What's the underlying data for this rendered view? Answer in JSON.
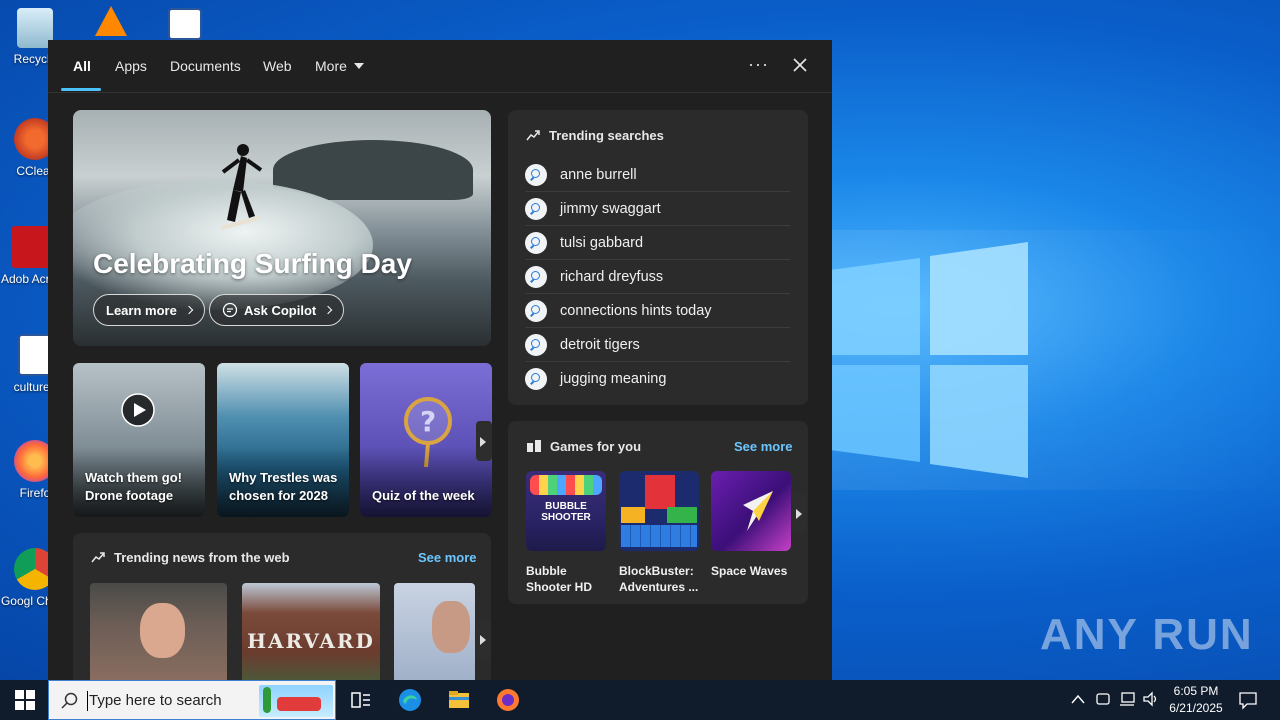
{
  "desktop": {
    "icons": [
      {
        "label": "Recycle"
      },
      {
        "label": "CClear"
      },
      {
        "label": "Adob Acrob"
      },
      {
        "label": "cultureh"
      },
      {
        "label": "Firefo"
      },
      {
        "label": "Googl Chron"
      }
    ],
    "watermark": "ANY RUN"
  },
  "tabs": {
    "all": "All",
    "apps": "Apps",
    "documents": "Documents",
    "web": "Web",
    "more": "More",
    "options": "···"
  },
  "hero": {
    "title": "Celebrating Surfing Day",
    "learn_more": "Learn more",
    "ask_copilot": "Ask Copilot"
  },
  "tiles": [
    {
      "caption": "Watch them go! Drone footage"
    },
    {
      "caption": "Why Trestles was chosen for 2028"
    },
    {
      "caption": "Quiz of the week"
    }
  ],
  "news": {
    "title": "Trending news from the web",
    "see_more": "See more",
    "harvard_text": "HARVARD"
  },
  "trending": {
    "title": "Trending searches",
    "items": [
      "anne burrell",
      "jimmy swaggart",
      "tulsi gabbard",
      "richard dreyfuss",
      "connections hints today",
      "detroit tigers",
      "jugging meaning"
    ]
  },
  "games": {
    "title": "Games for you",
    "see_more": "See more",
    "items": [
      {
        "name": "Bubble Shooter HD",
        "thumb_text": "BUBBLE SHOOTER"
      },
      {
        "name": "BlockBuster: Adventures ..."
      },
      {
        "name": "Space Waves"
      }
    ]
  },
  "taskbar": {
    "search_placeholder": "Type here to search",
    "time": "6:05 PM",
    "date": "6/21/2025"
  }
}
